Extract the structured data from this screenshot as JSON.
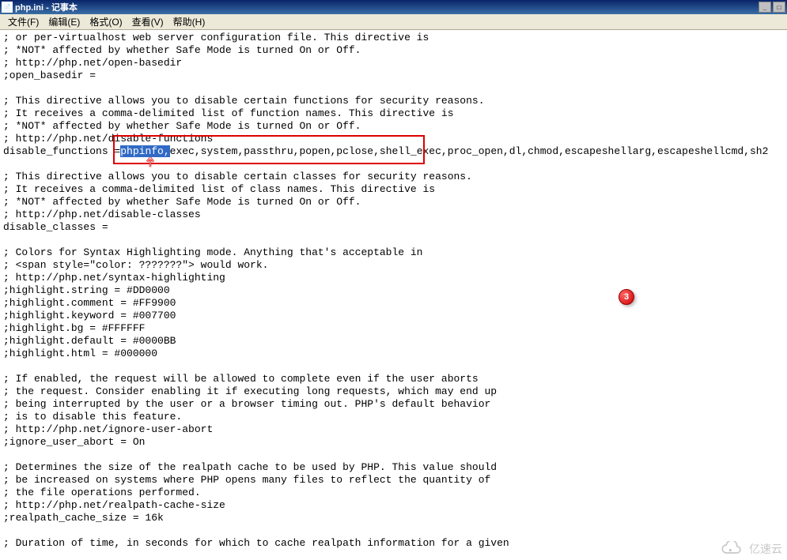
{
  "titlebar": {
    "title": "php.ini - 记事本"
  },
  "menu": {
    "file": "文件(F)",
    "edit": "编辑(E)",
    "format": "格式(O)",
    "view": "查看(V)",
    "help": "帮助(H)"
  },
  "badge_number": "3",
  "watermark": "亿速云",
  "annotation": {
    "selected_text": "phpinfo,"
  },
  "content": {
    "l01": "; or per-virtualhost web server configuration file. This directive is",
    "l02": "; *NOT* affected by whether Safe Mode is turned On or Off.",
    "l03": "; http://php.net/open-basedir",
    "l04": ";open_basedir =",
    "l05": "",
    "l06": "; This directive allows you to disable certain functions for security reasons.",
    "l07": "; It receives a comma-delimited list of function names. This directive is",
    "l08": "; *NOT* affected by whether Safe Mode is turned On or Off.",
    "l09": "; http://php.net/disable-functions",
    "l10_pre": "disable_functions =",
    "l10_sel": "phpinfo,",
    "l10_post": "exec,system,passthru,popen,pclose,shell_exec,proc_open,dl,chmod,escapeshellarg,escapeshellcmd,sh2",
    "l11": "",
    "l12": "; This directive allows you to disable certain classes for security reasons.",
    "l13": "; It receives a comma-delimited list of class names. This directive is",
    "l14": "; *NOT* affected by whether Safe Mode is turned On or Off.",
    "l15": "; http://php.net/disable-classes",
    "l16": "disable_classes =",
    "l17": "",
    "l18": "; Colors for Syntax Highlighting mode.  Anything that's acceptable in",
    "l19": "; <span style=\"color: ???????\"> would work.",
    "l20": "; http://php.net/syntax-highlighting",
    "l21": ";highlight.string  = #DD0000",
    "l22": ";highlight.comment = #FF9900",
    "l23": ";highlight.keyword = #007700",
    "l24": ";highlight.bg      = #FFFFFF",
    "l25": ";highlight.default = #0000BB",
    "l26": ";highlight.html    = #000000",
    "l27": "",
    "l28": "; If enabled, the request will be allowed to complete even if the user aborts",
    "l29": "; the request. Consider enabling it if executing long requests, which may end up",
    "l30": "; being interrupted by the user or a browser timing out. PHP's default behavior",
    "l31": "; is to disable this feature.",
    "l32": "; http://php.net/ignore-user-abort",
    "l33": ";ignore_user_abort = On",
    "l34": "",
    "l35": "; Determines the size of the realpath cache to be used by PHP. This value should",
    "l36": "; be increased on systems where PHP opens many files to reflect the quantity of",
    "l37": "; the file operations performed.",
    "l38": "; http://php.net/realpath-cache-size",
    "l39": ";realpath_cache_size = 16k",
    "l40": "",
    "l41": "; Duration of time, in seconds for which to cache realpath information for a given"
  }
}
